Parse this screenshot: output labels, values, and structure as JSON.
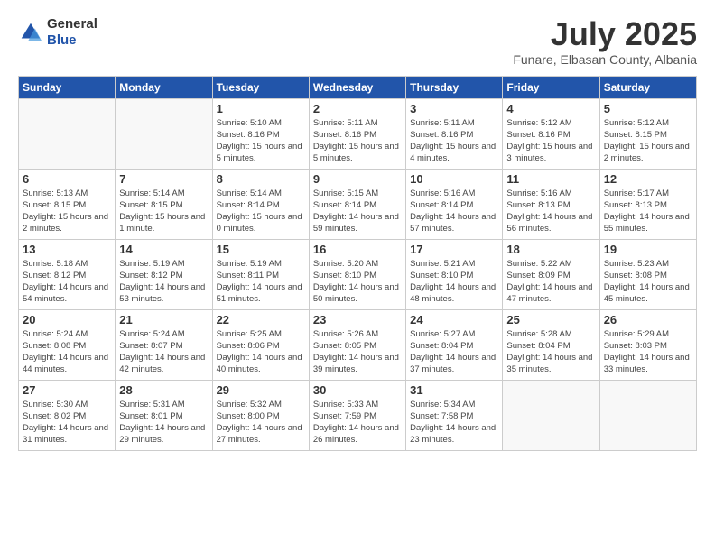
{
  "header": {
    "logo_general": "General",
    "logo_blue": "Blue",
    "month_title": "July 2025",
    "location": "Funare, Elbasan County, Albania"
  },
  "weekdays": [
    "Sunday",
    "Monday",
    "Tuesday",
    "Wednesday",
    "Thursday",
    "Friday",
    "Saturday"
  ],
  "weeks": [
    [
      {
        "day": "",
        "sunrise": "",
        "sunset": "",
        "daylight": ""
      },
      {
        "day": "",
        "sunrise": "",
        "sunset": "",
        "daylight": ""
      },
      {
        "day": "1",
        "sunrise": "Sunrise: 5:10 AM",
        "sunset": "Sunset: 8:16 PM",
        "daylight": "Daylight: 15 hours and 5 minutes."
      },
      {
        "day": "2",
        "sunrise": "Sunrise: 5:11 AM",
        "sunset": "Sunset: 8:16 PM",
        "daylight": "Daylight: 15 hours and 5 minutes."
      },
      {
        "day": "3",
        "sunrise": "Sunrise: 5:11 AM",
        "sunset": "Sunset: 8:16 PM",
        "daylight": "Daylight: 15 hours and 4 minutes."
      },
      {
        "day": "4",
        "sunrise": "Sunrise: 5:12 AM",
        "sunset": "Sunset: 8:16 PM",
        "daylight": "Daylight: 15 hours and 3 minutes."
      },
      {
        "day": "5",
        "sunrise": "Sunrise: 5:12 AM",
        "sunset": "Sunset: 8:15 PM",
        "daylight": "Daylight: 15 hours and 2 minutes."
      }
    ],
    [
      {
        "day": "6",
        "sunrise": "Sunrise: 5:13 AM",
        "sunset": "Sunset: 8:15 PM",
        "daylight": "Daylight: 15 hours and 2 minutes."
      },
      {
        "day": "7",
        "sunrise": "Sunrise: 5:14 AM",
        "sunset": "Sunset: 8:15 PM",
        "daylight": "Daylight: 15 hours and 1 minute."
      },
      {
        "day": "8",
        "sunrise": "Sunrise: 5:14 AM",
        "sunset": "Sunset: 8:14 PM",
        "daylight": "Daylight: 15 hours and 0 minutes."
      },
      {
        "day": "9",
        "sunrise": "Sunrise: 5:15 AM",
        "sunset": "Sunset: 8:14 PM",
        "daylight": "Daylight: 14 hours and 59 minutes."
      },
      {
        "day": "10",
        "sunrise": "Sunrise: 5:16 AM",
        "sunset": "Sunset: 8:14 PM",
        "daylight": "Daylight: 14 hours and 57 minutes."
      },
      {
        "day": "11",
        "sunrise": "Sunrise: 5:16 AM",
        "sunset": "Sunset: 8:13 PM",
        "daylight": "Daylight: 14 hours and 56 minutes."
      },
      {
        "day": "12",
        "sunrise": "Sunrise: 5:17 AM",
        "sunset": "Sunset: 8:13 PM",
        "daylight": "Daylight: 14 hours and 55 minutes."
      }
    ],
    [
      {
        "day": "13",
        "sunrise": "Sunrise: 5:18 AM",
        "sunset": "Sunset: 8:12 PM",
        "daylight": "Daylight: 14 hours and 54 minutes."
      },
      {
        "day": "14",
        "sunrise": "Sunrise: 5:19 AM",
        "sunset": "Sunset: 8:12 PM",
        "daylight": "Daylight: 14 hours and 53 minutes."
      },
      {
        "day": "15",
        "sunrise": "Sunrise: 5:19 AM",
        "sunset": "Sunset: 8:11 PM",
        "daylight": "Daylight: 14 hours and 51 minutes."
      },
      {
        "day": "16",
        "sunrise": "Sunrise: 5:20 AM",
        "sunset": "Sunset: 8:10 PM",
        "daylight": "Daylight: 14 hours and 50 minutes."
      },
      {
        "day": "17",
        "sunrise": "Sunrise: 5:21 AM",
        "sunset": "Sunset: 8:10 PM",
        "daylight": "Daylight: 14 hours and 48 minutes."
      },
      {
        "day": "18",
        "sunrise": "Sunrise: 5:22 AM",
        "sunset": "Sunset: 8:09 PM",
        "daylight": "Daylight: 14 hours and 47 minutes."
      },
      {
        "day": "19",
        "sunrise": "Sunrise: 5:23 AM",
        "sunset": "Sunset: 8:08 PM",
        "daylight": "Daylight: 14 hours and 45 minutes."
      }
    ],
    [
      {
        "day": "20",
        "sunrise": "Sunrise: 5:24 AM",
        "sunset": "Sunset: 8:08 PM",
        "daylight": "Daylight: 14 hours and 44 minutes."
      },
      {
        "day": "21",
        "sunrise": "Sunrise: 5:24 AM",
        "sunset": "Sunset: 8:07 PM",
        "daylight": "Daylight: 14 hours and 42 minutes."
      },
      {
        "day": "22",
        "sunrise": "Sunrise: 5:25 AM",
        "sunset": "Sunset: 8:06 PM",
        "daylight": "Daylight: 14 hours and 40 minutes."
      },
      {
        "day": "23",
        "sunrise": "Sunrise: 5:26 AM",
        "sunset": "Sunset: 8:05 PM",
        "daylight": "Daylight: 14 hours and 39 minutes."
      },
      {
        "day": "24",
        "sunrise": "Sunrise: 5:27 AM",
        "sunset": "Sunset: 8:04 PM",
        "daylight": "Daylight: 14 hours and 37 minutes."
      },
      {
        "day": "25",
        "sunrise": "Sunrise: 5:28 AM",
        "sunset": "Sunset: 8:04 PM",
        "daylight": "Daylight: 14 hours and 35 minutes."
      },
      {
        "day": "26",
        "sunrise": "Sunrise: 5:29 AM",
        "sunset": "Sunset: 8:03 PM",
        "daylight": "Daylight: 14 hours and 33 minutes."
      }
    ],
    [
      {
        "day": "27",
        "sunrise": "Sunrise: 5:30 AM",
        "sunset": "Sunset: 8:02 PM",
        "daylight": "Daylight: 14 hours and 31 minutes."
      },
      {
        "day": "28",
        "sunrise": "Sunrise: 5:31 AM",
        "sunset": "Sunset: 8:01 PM",
        "daylight": "Daylight: 14 hours and 29 minutes."
      },
      {
        "day": "29",
        "sunrise": "Sunrise: 5:32 AM",
        "sunset": "Sunset: 8:00 PM",
        "daylight": "Daylight: 14 hours and 27 minutes."
      },
      {
        "day": "30",
        "sunrise": "Sunrise: 5:33 AM",
        "sunset": "Sunset: 7:59 PM",
        "daylight": "Daylight: 14 hours and 26 minutes."
      },
      {
        "day": "31",
        "sunrise": "Sunrise: 5:34 AM",
        "sunset": "Sunset: 7:58 PM",
        "daylight": "Daylight: 14 hours and 23 minutes."
      },
      {
        "day": "",
        "sunrise": "",
        "sunset": "",
        "daylight": ""
      },
      {
        "day": "",
        "sunrise": "",
        "sunset": "",
        "daylight": ""
      }
    ]
  ]
}
